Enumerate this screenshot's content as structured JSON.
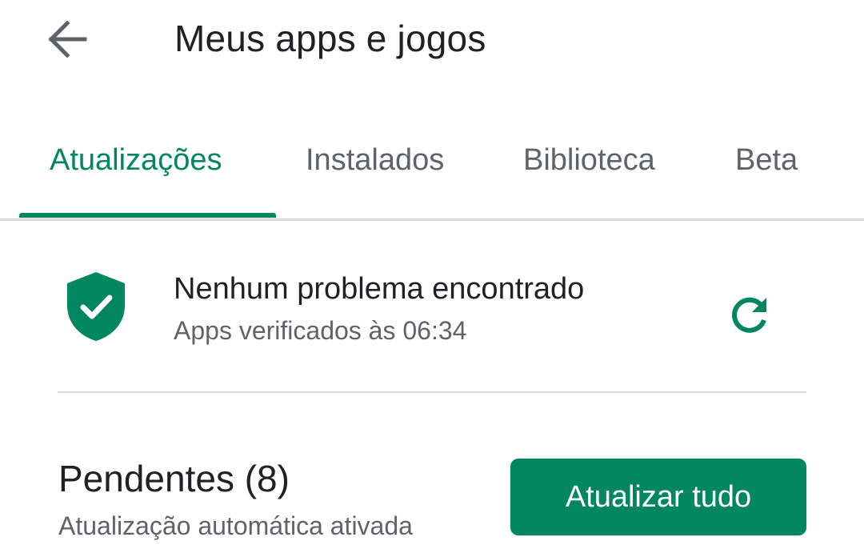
{
  "header": {
    "title": "Meus apps e jogos",
    "back_icon": "arrow-back-icon"
  },
  "tabs": [
    {
      "label": "Atualizações",
      "active": true
    },
    {
      "label": "Instalados",
      "active": false
    },
    {
      "label": "Biblioteca",
      "active": false
    },
    {
      "label": "Beta",
      "active": false
    }
  ],
  "protect": {
    "icon": "shield-check-icon",
    "title": "Nenhum problema encontrado",
    "subtitle": "Apps verificados às 06:34",
    "refresh_icon": "refresh-icon"
  },
  "pending": {
    "title": "Pendentes (8)",
    "subtitle": "Atualização automática ativada",
    "update_all_label": "Atualizar tudo"
  },
  "colors": {
    "accent": "#01875f",
    "text_primary": "#202124",
    "text_secondary": "#5f6368",
    "divider": "#dadce0"
  }
}
